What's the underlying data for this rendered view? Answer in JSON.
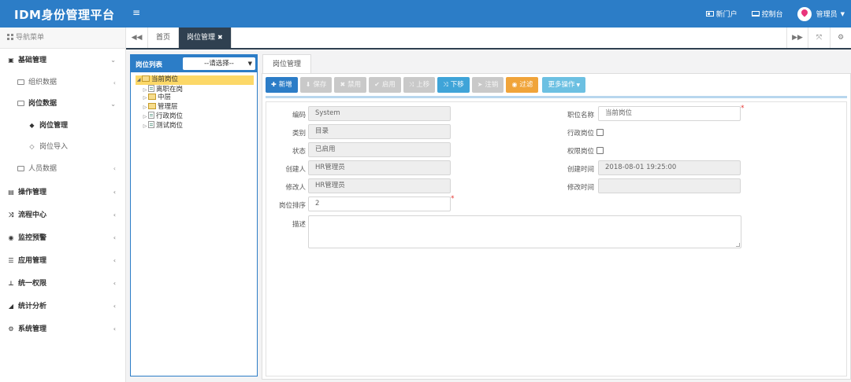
{
  "header": {
    "logo": "IDM身份管理平台",
    "menu_toggle": "≡",
    "portal": "新门户",
    "console": "控制台",
    "user": "管理员"
  },
  "sidebar": {
    "title": "导航菜单",
    "items": [
      {
        "label": "基础管理"
      },
      {
        "label": "组织数据"
      },
      {
        "label": "岗位数据"
      },
      {
        "label": "岗位管理"
      },
      {
        "label": "岗位导入"
      },
      {
        "label": "人员数据"
      },
      {
        "label": "操作管理"
      },
      {
        "label": "流程中心"
      },
      {
        "label": "监控预警"
      },
      {
        "label": "应用管理"
      },
      {
        "label": "统一权限"
      },
      {
        "label": "统计分析"
      },
      {
        "label": "系统管理"
      }
    ]
  },
  "tabs": {
    "home": "首页",
    "current": "岗位管理"
  },
  "tree": {
    "title": "岗位列表",
    "select_value": "--请选择--",
    "nodes": [
      {
        "label": "当前岗位"
      },
      {
        "label": "离职在岗"
      },
      {
        "label": "中层"
      },
      {
        "label": "管理层"
      },
      {
        "label": "行政岗位"
      },
      {
        "label": "测试岗位"
      }
    ]
  },
  "main": {
    "tab_label": "岗位管理",
    "toolbar": {
      "add": "新增",
      "save": "保存",
      "disable": "禁用",
      "enable": "启用",
      "move_up": "上移",
      "move_down": "下移",
      "cancel": "注销",
      "filter": "过滤",
      "more": "更多操作"
    },
    "form": {
      "code_label": "编码",
      "code_value": "System",
      "name_label": "职位名称",
      "name_value": "当前岗位",
      "category_label": "类别",
      "category_value": "目录",
      "admin_post_label": "行政岗位",
      "status_label": "状态",
      "status_value": "已启用",
      "perm_post_label": "权限岗位",
      "creator_label": "创建人",
      "creator_value": "HR管理员",
      "created_time_label": "创建时间",
      "created_time_value": "2018-08-01 19:25:00",
      "modifier_label": "修改人",
      "modifier_value": "HR管理员",
      "modified_time_label": "修改时间",
      "modified_time_value": "",
      "sort_label": "岗位排序",
      "sort_value": "2",
      "desc_label": "描述",
      "required_mark": "*"
    }
  },
  "colors": {
    "brand": "#2c7dc7",
    "tab_active": "#2f4050",
    "tree_selected": "#fcd868",
    "filter_button": "#f0a43a"
  }
}
